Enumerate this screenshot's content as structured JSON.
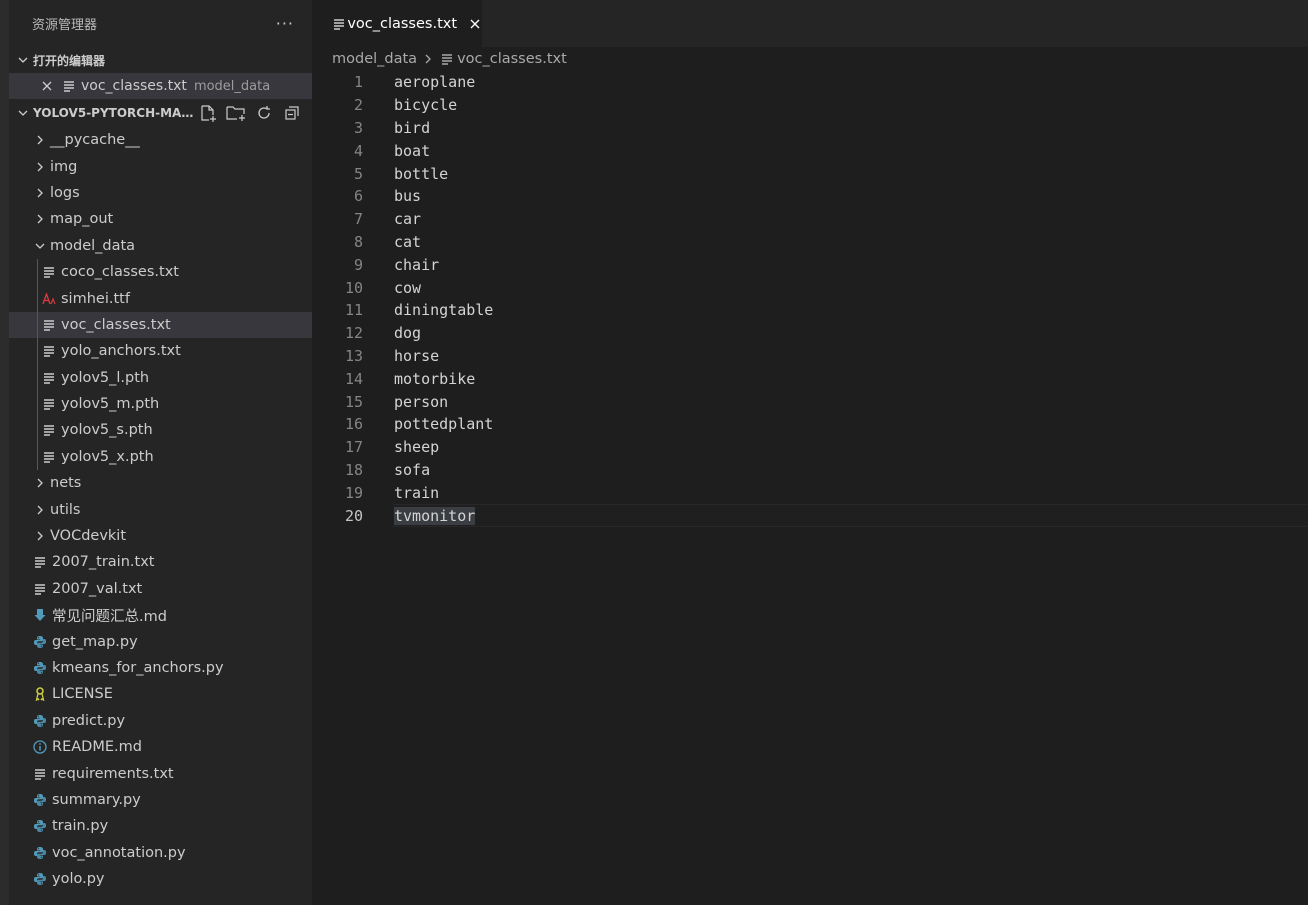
{
  "sidebar": {
    "title": "资源管理器",
    "more": "···",
    "open_editors_title": "打开的编辑器",
    "open_editor": {
      "name": "voc_classes.txt",
      "desc": "model_data"
    },
    "project_title": "YOLOV5-PYTORCH-MAS...",
    "tree": [
      {
        "label": "__pycache__",
        "kind": "folder",
        "level": 0,
        "expanded": false
      },
      {
        "label": "img",
        "kind": "folder",
        "level": 0,
        "expanded": false
      },
      {
        "label": "logs",
        "kind": "folder",
        "level": 0,
        "expanded": false
      },
      {
        "label": "map_out",
        "kind": "folder",
        "level": 0,
        "expanded": false
      },
      {
        "label": "model_data",
        "kind": "folder",
        "level": 0,
        "expanded": true
      },
      {
        "label": "coco_classes.txt",
        "kind": "txt",
        "level": 1
      },
      {
        "label": "simhei.ttf",
        "kind": "font",
        "level": 1
      },
      {
        "label": "voc_classes.txt",
        "kind": "txt",
        "level": 1,
        "selected": true
      },
      {
        "label": "yolo_anchors.txt",
        "kind": "txt",
        "level": 1
      },
      {
        "label": "yolov5_l.pth",
        "kind": "txt",
        "level": 1
      },
      {
        "label": "yolov5_m.pth",
        "kind": "txt",
        "level": 1
      },
      {
        "label": "yolov5_s.pth",
        "kind": "txt",
        "level": 1
      },
      {
        "label": "yolov5_x.pth",
        "kind": "txt",
        "level": 1
      },
      {
        "label": "nets",
        "kind": "folder",
        "level": 0,
        "expanded": false
      },
      {
        "label": "utils",
        "kind": "folder",
        "level": 0,
        "expanded": false
      },
      {
        "label": "VOCdevkit",
        "kind": "folder",
        "level": 0,
        "expanded": false
      },
      {
        "label": "2007_train.txt",
        "kind": "txt",
        "level": 0
      },
      {
        "label": "2007_val.txt",
        "kind": "txt",
        "level": 0
      },
      {
        "label": "常见问题汇总.md",
        "kind": "md",
        "level": 0
      },
      {
        "label": "get_map.py",
        "kind": "py",
        "level": 0
      },
      {
        "label": "kmeans_for_anchors.py",
        "kind": "py",
        "level": 0
      },
      {
        "label": "LICENSE",
        "kind": "license",
        "level": 0
      },
      {
        "label": "predict.py",
        "kind": "py",
        "level": 0
      },
      {
        "label": "README.md",
        "kind": "info",
        "level": 0
      },
      {
        "label": "requirements.txt",
        "kind": "txt",
        "level": 0
      },
      {
        "label": "summary.py",
        "kind": "py",
        "level": 0
      },
      {
        "label": "train.py",
        "kind": "py",
        "level": 0
      },
      {
        "label": "voc_annotation.py",
        "kind": "py",
        "level": 0
      },
      {
        "label": "yolo.py",
        "kind": "py",
        "level": 0
      }
    ]
  },
  "editor": {
    "tab": {
      "label": "voc_classes.txt"
    },
    "breadcrumb": {
      "folder": "model_data",
      "file": "voc_classes.txt"
    },
    "current_line": 20,
    "lines": [
      "aeroplane",
      "bicycle",
      "bird",
      "boat",
      "bottle",
      "bus",
      "car",
      "cat",
      "chair",
      "cow",
      "diningtable",
      "dog",
      "horse",
      "motorbike",
      "person",
      "pottedplant",
      "sheep",
      "sofa",
      "train",
      "tvmonitor"
    ]
  },
  "colors": {
    "python_icon": "#519aba",
    "font_icon": "#e03a3a",
    "md_icon": "#519aba",
    "license_icon": "#cbcb41",
    "info_icon": "#519aba"
  }
}
